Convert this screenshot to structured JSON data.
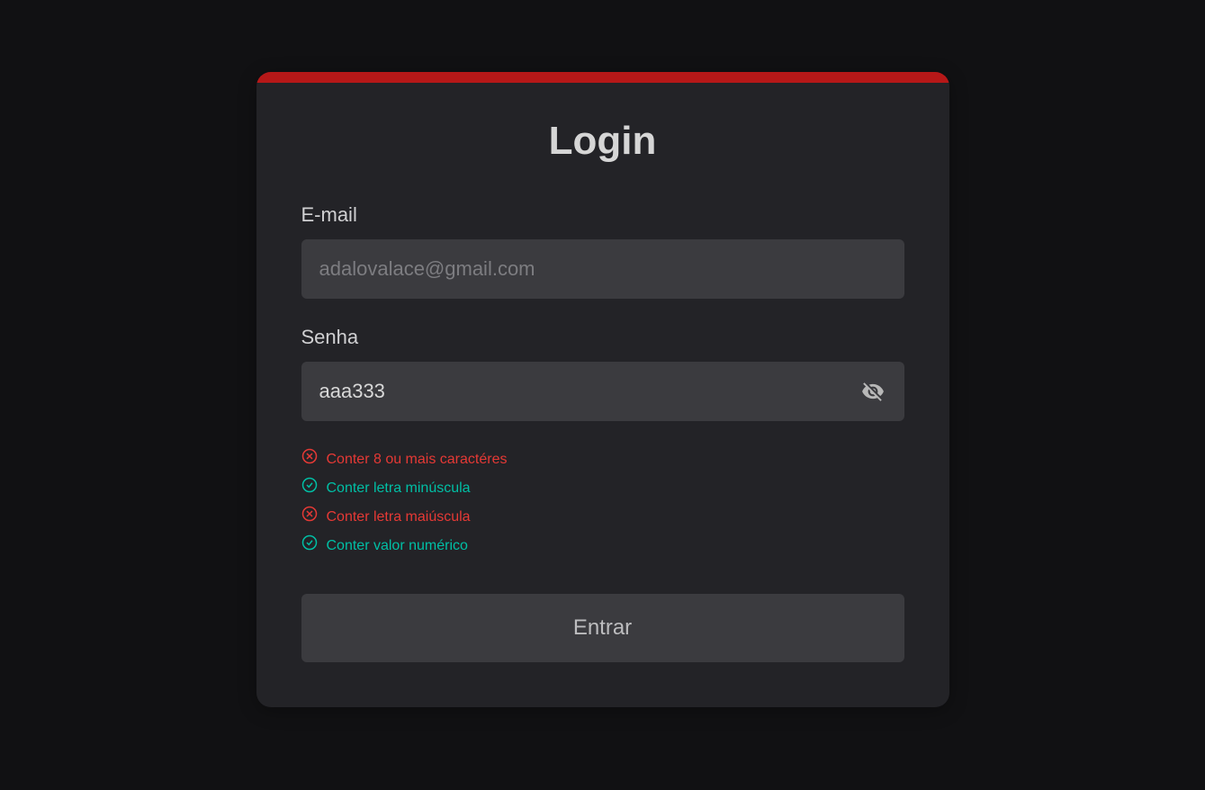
{
  "heading": "Login",
  "email": {
    "label": "E-mail",
    "placeholder": "adalovalace@gmail.com",
    "value": ""
  },
  "password": {
    "label": "Senha",
    "value": "aaa333"
  },
  "validations": [
    {
      "text": "Conter 8 ou mais caractéres",
      "valid": false
    },
    {
      "text": "Conter letra minúscula",
      "valid": true
    },
    {
      "text": "Conter letra maiúscula",
      "valid": false
    },
    {
      "text": "Conter valor numérico",
      "valid": true
    }
  ],
  "submit_label": "Entrar"
}
